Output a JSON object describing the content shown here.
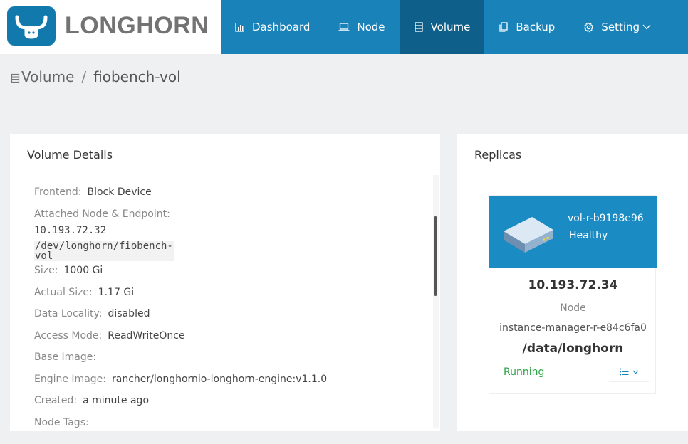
{
  "app": {
    "logo_text": "LONGHORN"
  },
  "nav": {
    "items": [
      {
        "label": "Dashboard",
        "icon": "bar-chart-icon"
      },
      {
        "label": "Node",
        "icon": "laptop-icon"
      },
      {
        "label": "Volume",
        "icon": "database-icon",
        "active": true
      },
      {
        "label": "Backup",
        "icon": "copy-icon"
      },
      {
        "label": "Setting",
        "icon": "gear-icon"
      }
    ]
  },
  "breadcrumb": {
    "root": "Volume",
    "separator": "/",
    "current": "fiobench-vol"
  },
  "details": {
    "title": "Volume Details",
    "frontend": {
      "label": "Frontend:",
      "value": "Block Device"
    },
    "attached": {
      "label": "Attached Node & Endpoint:",
      "node": "10.193.72.32",
      "endpoint": "/dev/longhorn/fiobench-vol"
    },
    "size": {
      "label": "Size:",
      "value": "1000 Gi"
    },
    "actual_size": {
      "label": "Actual Size:",
      "value": "1.17 Gi"
    },
    "data_locality": {
      "label": "Data Locality:",
      "value": "disabled"
    },
    "access_mode": {
      "label": "Access Mode:",
      "value": "ReadWriteOnce"
    },
    "base_image": {
      "label": "Base Image:",
      "value": ""
    },
    "engine_image": {
      "label": "Engine Image:",
      "value": "rancher/longhornio-longhorn-engine:v1.1.0"
    },
    "created": {
      "label": "Created:",
      "value": "a minute ago"
    },
    "node_tags": {
      "label": "Node Tags:",
      "value": ""
    }
  },
  "replicas": {
    "title": "Replicas",
    "items": [
      {
        "name": "vol-r-b9198e96",
        "health": "Healthy",
        "ip": "10.193.72.34",
        "node_label": "Node",
        "instance_manager": "instance-manager-r-e84c6fa0",
        "path": "/data/longhorn",
        "status": "Running"
      }
    ]
  },
  "colors": {
    "header": "#1982b8",
    "active_nav": "#0e5f8a",
    "replica_card": "#1b8bc4",
    "running": "#27a243"
  }
}
